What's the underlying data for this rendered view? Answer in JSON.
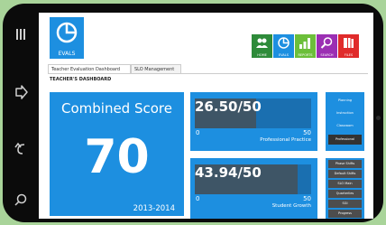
{
  "app": {
    "logo_text": "EVALS"
  },
  "nav": [
    {
      "label": "HOME",
      "color": "#2e8b3a",
      "icon": "people-icon"
    },
    {
      "label": "EVALS",
      "color": "#1d8fe0",
      "icon": "pie-chart-icon"
    },
    {
      "label": "REPORTS",
      "color": "#6cbf3a",
      "icon": "bar-chart-icon"
    },
    {
      "label": "SEARCH",
      "color": "#9b2fb3",
      "icon": "magnifier-icon"
    },
    {
      "label": "FILES",
      "color": "#e02b2b",
      "icon": "files-icon"
    }
  ],
  "tabs": [
    {
      "label": "Teacher Evaluation Dashboard"
    },
    {
      "label": "SLO Management"
    }
  ],
  "page_title": "TEACHER'S DASHBOARD",
  "combined": {
    "title": "Combined Score",
    "score": "70",
    "year": "2013-2014"
  },
  "cards": [
    {
      "value": "26.50/50",
      "min": "0",
      "max": "50",
      "name": "Professional Practice",
      "fraction": 0.53
    },
    {
      "value": "43.94/50",
      "min": "0",
      "max": "50",
      "name": "Student Growth",
      "fraction": 0.88
    }
  ],
  "side_top": [
    {
      "label": "Planning"
    },
    {
      "label": "Instruction"
    },
    {
      "label": "Classroom"
    },
    {
      "label": "Professional"
    }
  ],
  "side_bottom": [
    {
      "label": "Phase Shifts"
    },
    {
      "label": "Default Shifts"
    },
    {
      "label": "SLO Main"
    },
    {
      "label": "Quarterlies"
    },
    {
      "label": "SGI"
    },
    {
      "label": "Progress"
    }
  ],
  "colors": {
    "accent": "#1d8fe0",
    "bar_track": "#1a6fb0",
    "bar_fill": "#3e5566",
    "background": "#a9d49a"
  }
}
